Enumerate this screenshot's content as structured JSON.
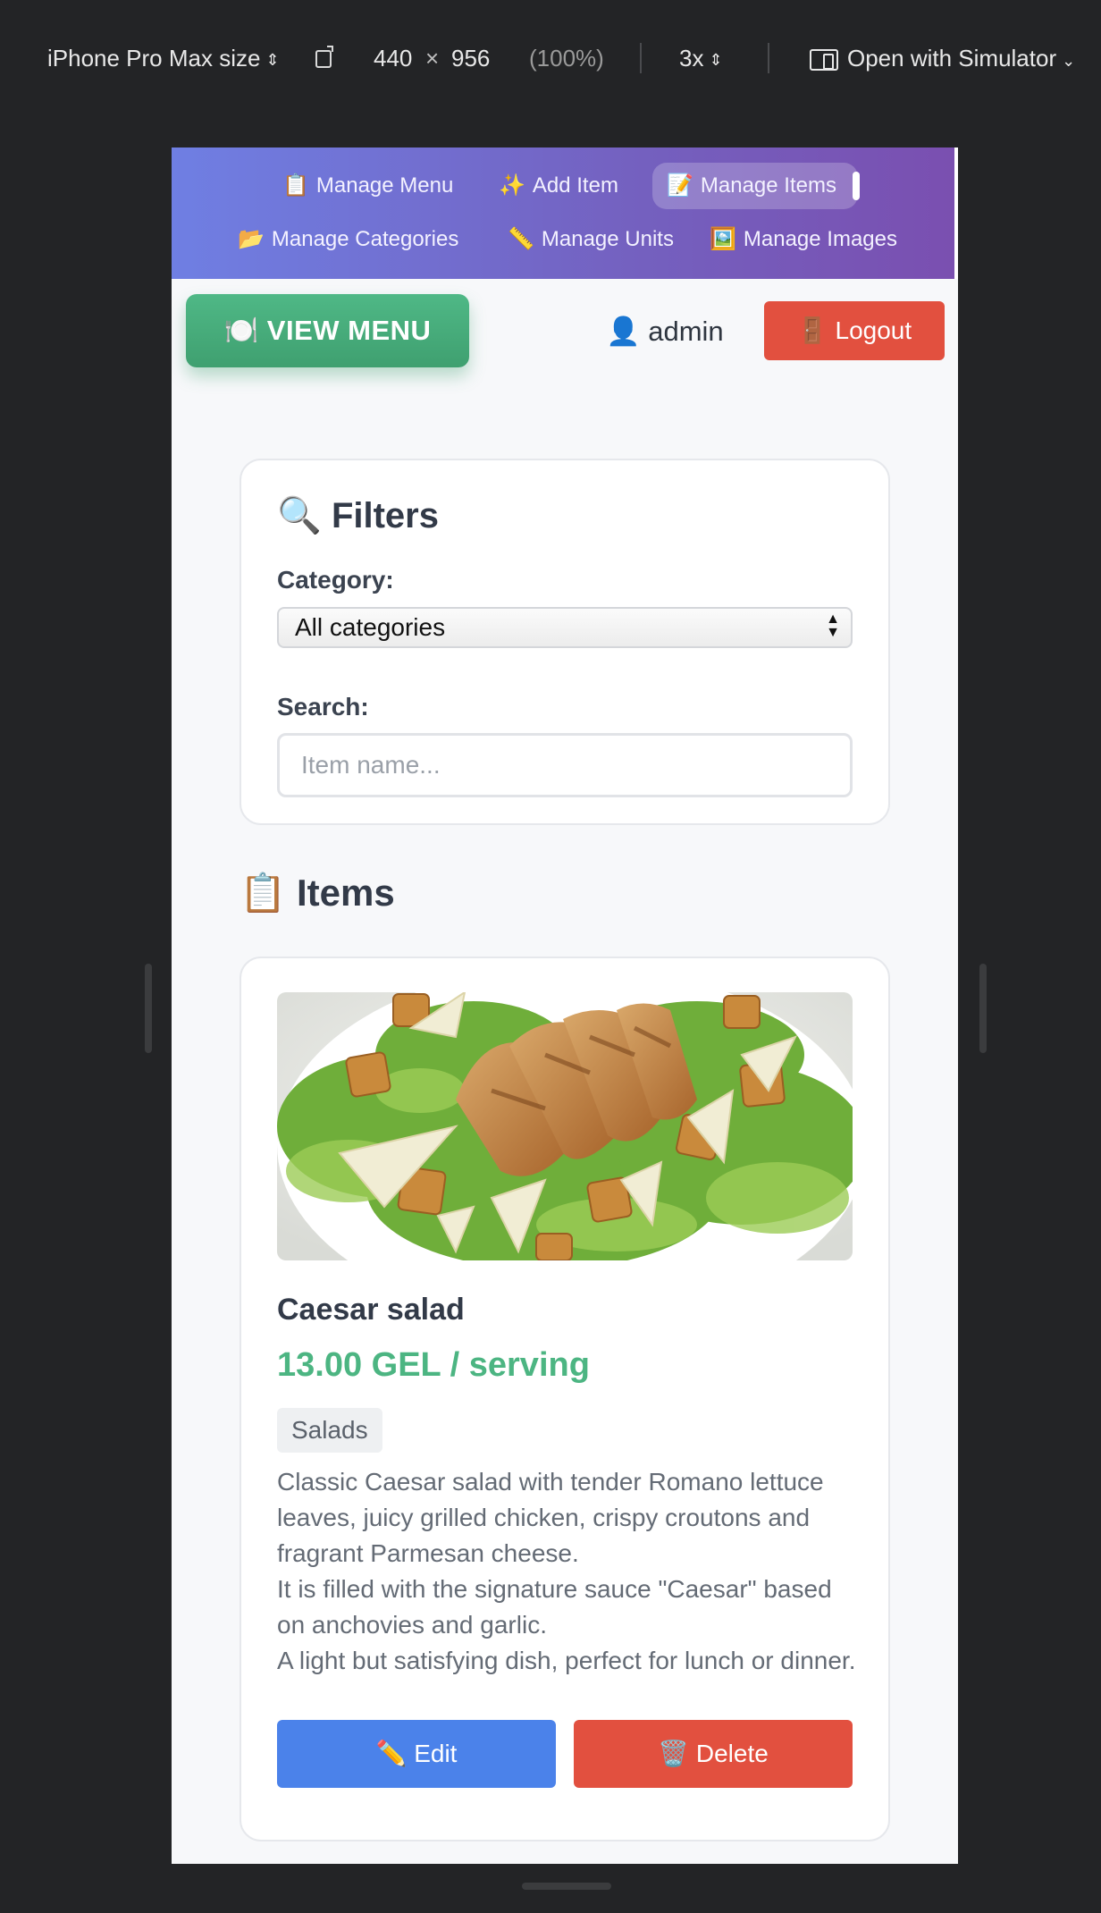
{
  "devtools": {
    "device": "iPhone Pro Max size",
    "width": "440",
    "times": "×",
    "height": "956",
    "zoom": "(100%)",
    "dpr": "3x",
    "simulator": "Open with Simulator"
  },
  "nav": {
    "items": [
      {
        "emoji": "📋",
        "label": "Manage Menu"
      },
      {
        "emoji": "✨",
        "label": "Add Item"
      },
      {
        "emoji": "📝",
        "label": "Manage Items",
        "active": true
      },
      {
        "emoji": "📂",
        "label": "Manage Categories"
      },
      {
        "emoji": "📏",
        "label": "Manage Units"
      },
      {
        "emoji": "🖼️",
        "label": "Manage Images"
      }
    ]
  },
  "header": {
    "view_menu_emoji": "🍽️",
    "view_menu_label": "VIEW MENU",
    "user_emoji": "👤",
    "username": "admin",
    "logout_emoji": "🚪",
    "logout_label": "Logout"
  },
  "filters": {
    "title_emoji": "🔍",
    "title": "Filters",
    "category_label": "Category:",
    "category_value": "All categories",
    "search_label": "Search:",
    "search_placeholder": "Item name..."
  },
  "items_section": {
    "title_emoji": "📋",
    "title": "Items"
  },
  "items": [
    {
      "name": "Caesar salad",
      "price": "13.00 GEL / serving",
      "category": "Salads",
      "description": "Classic Caesar salad with tender Romano lettuce leaves, juicy grilled chicken, crispy croutons and fragrant Parmesan cheese.\nIt is filled with the signature sauce \"Caesar\" based on anchovies and garlic.\nA light but satisfying dish, perfect for lunch or dinner.",
      "edit_emoji": "✏️",
      "edit_label": "Edit",
      "delete_emoji": "🗑️",
      "delete_label": "Delete"
    }
  ],
  "colors": {
    "nav_gradient_start": "#6f7fe3",
    "nav_gradient_end": "#7a4fb0",
    "view_menu": "#4fb886",
    "logout": "#e2503f",
    "price": "#4cb582",
    "edit": "#4b82ea",
    "delete": "#e2503f"
  }
}
